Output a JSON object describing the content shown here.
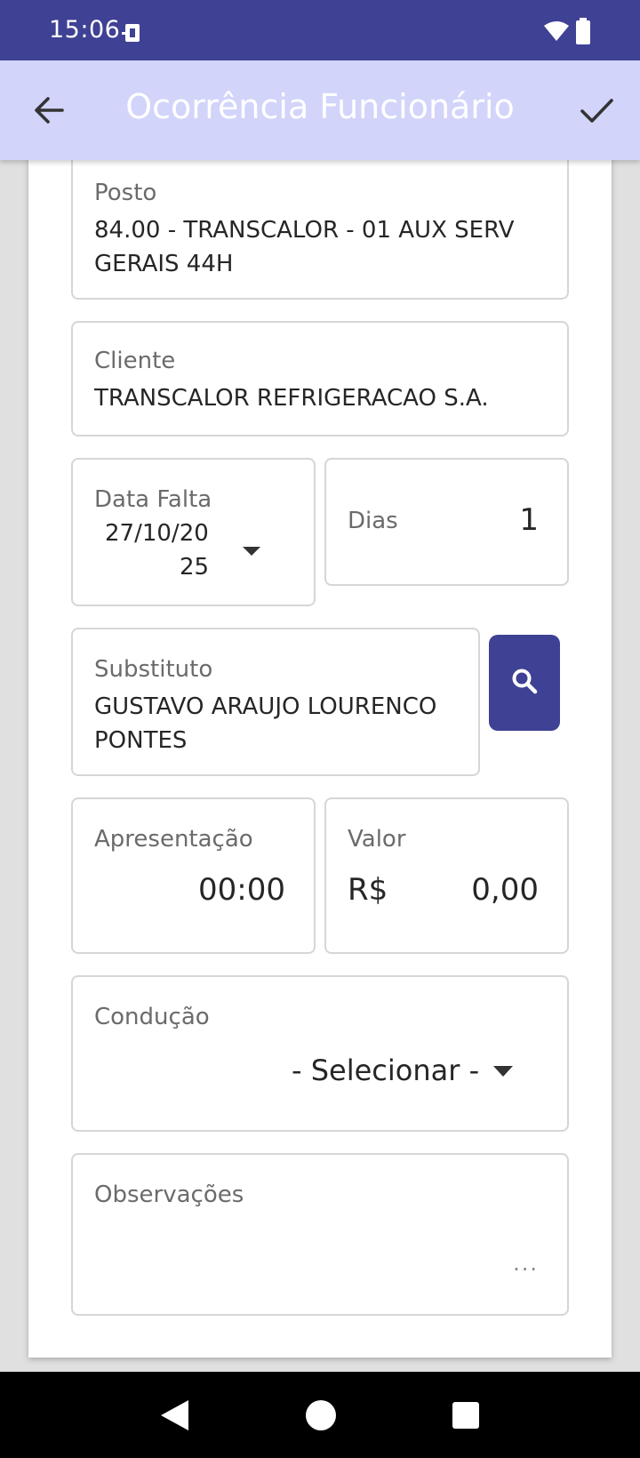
{
  "status_bar": {
    "time": "15:06"
  },
  "app_bar": {
    "title": "Ocorrência Funcionário"
  },
  "form": {
    "posto": {
      "label": "Posto",
      "value": "84.00 - TRANSCALOR - 01 AUX SERV GERAIS 44H"
    },
    "cliente": {
      "label": "Cliente",
      "value": "TRANSCALOR REFRIGERACAO S.A."
    },
    "data_falta": {
      "label": "Data Falta",
      "value_line1": "27/10/20",
      "value_line2": "25"
    },
    "dias": {
      "label": "Dias",
      "value": "1"
    },
    "substituto": {
      "label": "Substituto",
      "value": "GUSTAVO ARAUJO LOURENCO PONTES"
    },
    "apresentacao": {
      "label": "Apresentação",
      "value": "00:00"
    },
    "valor": {
      "label": "Valor",
      "currency": "R$",
      "value": "0,00"
    },
    "conducao": {
      "label": "Condução",
      "value": "- Selecionar -"
    },
    "observacoes": {
      "label": "Observações",
      "more": "..."
    }
  },
  "colors": {
    "primary": "#3f4195",
    "app_bar": "#d2d4fa"
  }
}
